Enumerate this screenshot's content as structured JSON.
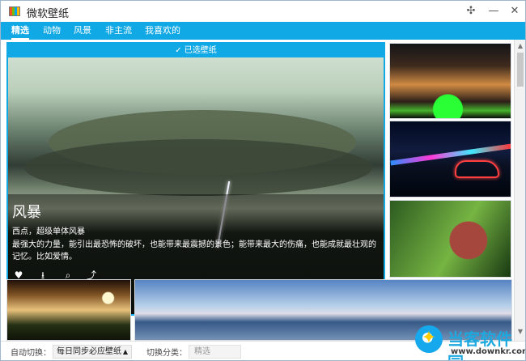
{
  "window": {
    "title": "微软壁纸",
    "pin_icon": "pin-icon",
    "minimize_icon": "minimize-icon",
    "close_icon": "close-icon"
  },
  "tabs": [
    {
      "label": "精选",
      "active": true
    },
    {
      "label": "动物",
      "active": false
    },
    {
      "label": "风景",
      "active": false
    },
    {
      "label": "非主流",
      "active": false
    },
    {
      "label": "我喜欢的",
      "active": false
    }
  ],
  "featured": {
    "selected_label": "已选壁纸",
    "title": "风暴",
    "subtitle": "西点，超级单体风暴",
    "description": "最强大的力量，能引出最恐怖的破坏，也能带来最震撼的景色；能带来最大的伤痛，也能成就最壮观的记忆。比如爱情。",
    "actions": [
      "heart-icon",
      "download-icon",
      "search-icon",
      "share-icon"
    ]
  },
  "thumbnails": [
    {
      "subject": "illuminated arches"
    },
    {
      "subject": "neon car"
    },
    {
      "subject": "red fruit in leaves"
    },
    {
      "subject": "sunlit cave"
    },
    {
      "subject": "mountain clouds"
    }
  ],
  "status": {
    "auto_switch_label": "自动切换：",
    "auto_switch_value": "每日同步必应壁纸",
    "switch_category_label": "切换分类：",
    "switch_category_value": "精选"
  },
  "watermark": {
    "title": "当客软件园",
    "url": "www.downkr.com"
  },
  "colors": {
    "accent": "#11a8e6",
    "watermark_blue": "#1da9df"
  }
}
